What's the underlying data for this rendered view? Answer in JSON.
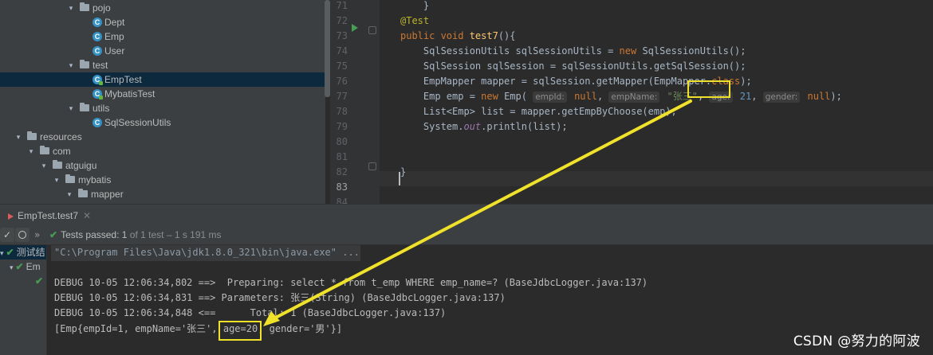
{
  "project_tree": {
    "rows": [
      {
        "label": "pojo",
        "type": "package",
        "expanded": true
      },
      {
        "label": "Dept",
        "type": "class"
      },
      {
        "label": "Emp",
        "type": "class"
      },
      {
        "label": "User",
        "type": "class"
      },
      {
        "label": "test",
        "type": "package",
        "expanded": true
      },
      {
        "label": "EmpTest",
        "type": "test-class",
        "selected": true
      },
      {
        "label": "MybatisTest",
        "type": "test-class"
      },
      {
        "label": "utils",
        "type": "package",
        "expanded": true
      },
      {
        "label": "SqlSessionUtils",
        "type": "class"
      },
      {
        "label": "resources",
        "type": "resources-folder",
        "expanded": true
      },
      {
        "label": "com",
        "type": "folder",
        "expanded": true
      },
      {
        "label": "atguigu",
        "type": "folder",
        "expanded": true
      },
      {
        "label": "mybatis",
        "type": "folder",
        "expanded": true
      },
      {
        "label": "mapper",
        "type": "folder",
        "expanded": true
      }
    ]
  },
  "editor": {
    "lines": [
      {
        "num": "71",
        "text": "    }"
      },
      {
        "num": "72",
        "parts": [
          [
            "ann",
            "@Test"
          ]
        ]
      },
      {
        "num": "73",
        "parts": [
          [
            "kw",
            "public void "
          ],
          [
            "fn",
            "test7"
          ],
          [
            "p",
            "(){"
          ]
        ]
      },
      {
        "num": "74",
        "parts": [
          [
            "p",
            "    SqlSessionUtils sqlSessionUtils = "
          ],
          [
            "kw",
            "new "
          ],
          [
            "p",
            "SqlSessionUtils();"
          ]
        ]
      },
      {
        "num": "75",
        "parts": [
          [
            "p",
            "    SqlSession sqlSession = sqlSessionUtils.getSqlSession();"
          ]
        ]
      },
      {
        "num": "76",
        "parts": [
          [
            "p",
            "    EmpMapper mapper = sqlSession.getMapper(EmpMapper."
          ],
          [
            "kw",
            "class"
          ],
          [
            "p",
            ");"
          ]
        ]
      },
      {
        "num": "77",
        "parts": [
          [
            "p",
            "    Emp emp = "
          ],
          [
            "kw",
            "new "
          ],
          [
            "p",
            "Emp( "
          ],
          [
            "hint",
            "empId:"
          ],
          [
            "kw",
            " null"
          ],
          [
            "p",
            ", "
          ],
          [
            "hint",
            "empName:"
          ],
          [
            "str",
            " \"张三\""
          ],
          [
            "p",
            ", "
          ],
          [
            "hint",
            "age:"
          ],
          [
            "num",
            " 21"
          ],
          [
            "p",
            ", "
          ],
          [
            "hint",
            "gender:"
          ],
          [
            "kw",
            " null"
          ],
          [
            "p",
            ");"
          ]
        ]
      },
      {
        "num": "78",
        "parts": [
          [
            "p",
            "    List<Emp> list = mapper.getEmpByChoose(emp);"
          ]
        ]
      },
      {
        "num": "79",
        "parts": [
          [
            "p",
            "    System."
          ],
          [
            "fld",
            "out"
          ],
          [
            "p",
            ".println(list);"
          ]
        ]
      },
      {
        "num": "80",
        "parts": []
      },
      {
        "num": "81",
        "parts": []
      },
      {
        "num": "82",
        "parts": [
          [
            "p",
            "}"
          ]
        ]
      },
      {
        "num": "83",
        "parts": [],
        "current": true
      },
      {
        "num": "84",
        "parts": []
      }
    ]
  },
  "run_panel": {
    "tab_label": "EmpTest.test7",
    "tests_passed_label": "Tests passed: ",
    "tests_passed_count": "1",
    "tests_passed_detail": " of 1 test – 1 s 191 ms",
    "test_tree": [
      {
        "label": "测试结",
        "arrow": "▾"
      },
      {
        "label": "Em",
        "arrow": "▾"
      },
      {
        "label": "",
        "arrow": ""
      }
    ],
    "console_lines": [
      "\"C:\\Program Files\\Java\\jdk1.8.0_321\\bin\\java.exe\" ...",
      "",
      "DEBUG 10-05 12:06:34,802 ==>  Preparing: select * from t_emp WHERE emp_name=? (BaseJdbcLogger.java:137)",
      "DEBUG 10-05 12:06:34,831 ==> Parameters: 张三(String) (BaseJdbcLogger.java:137)",
      "DEBUG 10-05 12:06:34,848 <==      Total: 1 (BaseJdbcLogger.java:137)",
      "[Emp{empId=1, empName='张三', age=20, gender='男'}]"
    ]
  },
  "annotation": {
    "color": "#f0e22a"
  },
  "watermark": "CSDN @努力的阿波",
  "colors": {
    "keyword": "#cc7832",
    "annotation": "#bbb529",
    "function": "#ffc66d",
    "string": "#6a8759",
    "number": "#6897bb",
    "passed": "#499c54"
  }
}
